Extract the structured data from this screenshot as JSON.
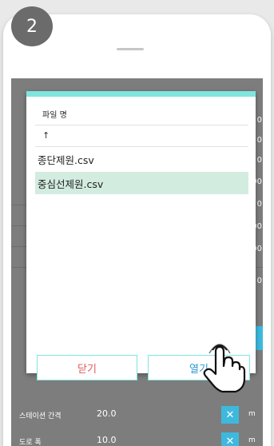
{
  "step_badge": "2",
  "dialog": {
    "header": "파일 명",
    "up_label": "↑",
    "files": [
      {
        "name": "종단제원.csv",
        "selected": false
      },
      {
        "name": "중심선제원.csv",
        "selected": true
      }
    ],
    "close_label": "닫기",
    "open_label": "열기"
  },
  "background": {
    "right_fragments": [
      "0",
      "0",
      "0",
      "000",
      "0",
      "500",
      "000",
      "0"
    ],
    "rows": [
      {
        "label": "스테이션 간격",
        "value": "20.0",
        "unit": "m"
      },
      {
        "label": "도로 폭",
        "value": "10.0",
        "unit": "m"
      }
    ]
  },
  "colors": {
    "accent_teal": "#7fe5de",
    "selected_row": "#d2ece0",
    "close_text": "#e05a5a",
    "open_text": "#2e9ad6",
    "x_button": "#3eb9dd"
  },
  "icons": {
    "clear": "close-icon",
    "pointer": "tap-hand-icon"
  }
}
